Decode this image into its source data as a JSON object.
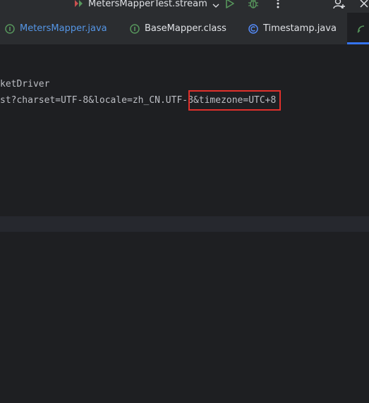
{
  "toolbar": {
    "run_config_label": "MetersMapperTest.stream",
    "run_config_icon": "test-config-icon",
    "run_icon": "run-icon",
    "debug_icon": "debug-icon",
    "more_icon": "more-vertical-icon",
    "add_user_icon": "add-user-icon",
    "close_icon": "close-icon"
  },
  "tabs": [
    {
      "label": "MetersMapper.java",
      "icon": "interface-icon",
      "color": "#5596e6"
    },
    {
      "label": "BaseMapper.class",
      "icon": "interface-icon",
      "color": "#dfe1e5"
    },
    {
      "label": "Timestamp.java",
      "icon": "class-icon",
      "color": "#dfe1e5"
    },
    {
      "label": "",
      "icon": "config-file-icon",
      "active": true
    }
  ],
  "editor": {
    "lines": [
      "ketDriver",
      "st?charset=UTF-8&locale=zh_CN.UTF-8&timezone=UTC+8"
    ],
    "line2_before": "st?charset=UTF-8&locale=zh_CN.UTF-8",
    "line2_highlight": "&timezone=UTC+8"
  },
  "colors": {
    "background": "#1e1f22",
    "toolbar": "#2b2d30",
    "accent": "#3574f0",
    "highlight_box": "#e0302b",
    "run_green": "#57965c"
  }
}
